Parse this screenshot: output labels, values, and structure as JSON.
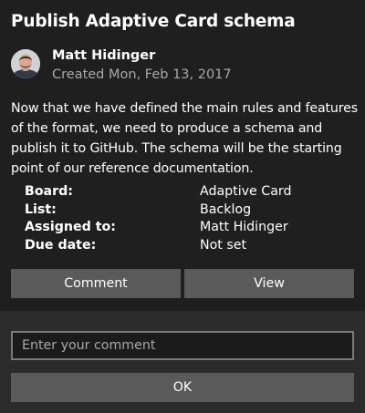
{
  "card": {
    "title": "Publish Adaptive Card schema",
    "author": {
      "name": "Matt Hidinger",
      "created": "Created Mon, Feb 13, 2017"
    },
    "description": "Now that we have defined the main rules and features of the format, we need to produce a schema and publish it to GitHub. The schema will be the starting point of our reference documentation.",
    "facts": [
      {
        "label": "Board:",
        "value": "Adaptive Card"
      },
      {
        "label": "List:",
        "value": "Backlog"
      },
      {
        "label": "Assigned to:",
        "value": "Matt Hidinger"
      },
      {
        "label": "Due date:",
        "value": "Not set"
      }
    ],
    "actions": {
      "comment_label": "Comment",
      "view_label": "View"
    }
  },
  "comment_form": {
    "placeholder": "Enter your comment",
    "value": "",
    "ok_label": "OK"
  },
  "colors": {
    "background": "#1f1f1f",
    "panel": "#2b2b2b",
    "button": "#5a5a5a",
    "text": "#ffffff",
    "muted_text": "#a8a8a8"
  }
}
